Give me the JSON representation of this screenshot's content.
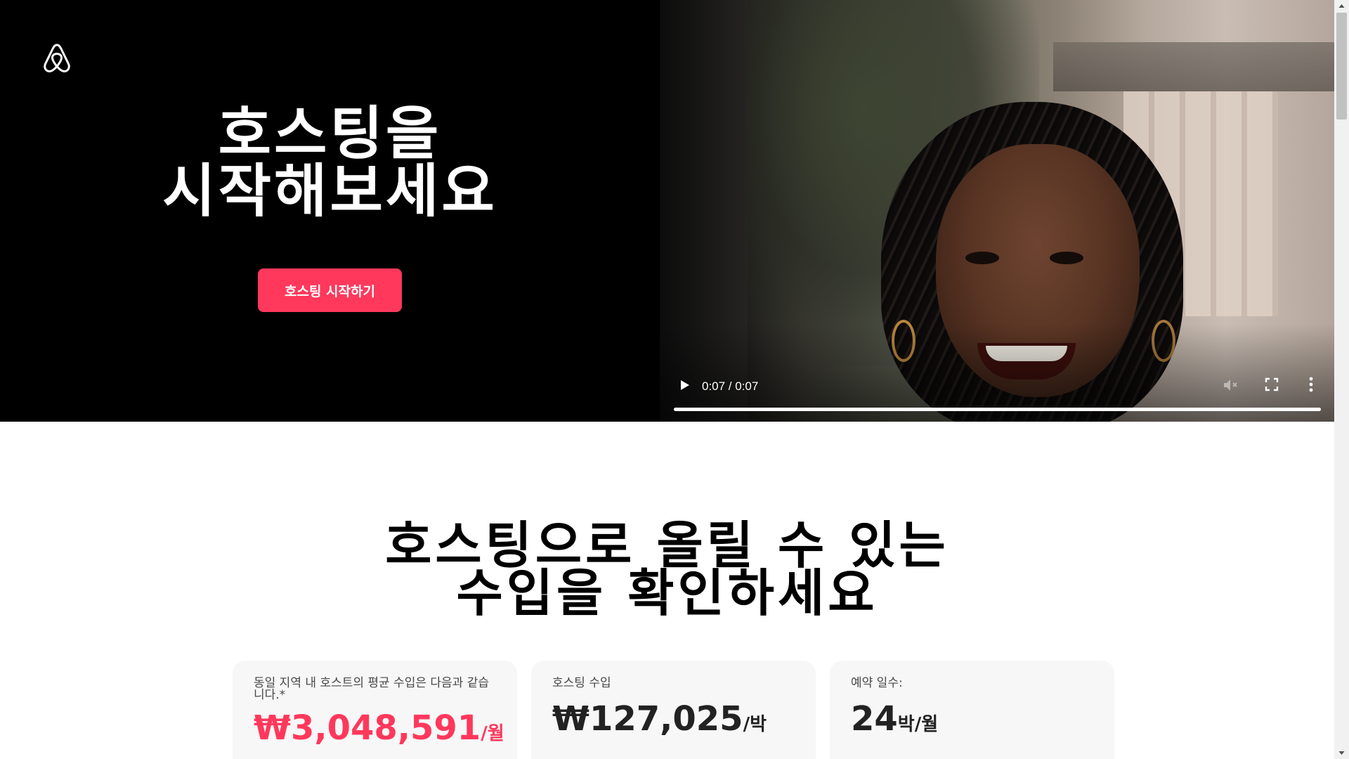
{
  "hero": {
    "logo_icon": "airbnb-logo-icon",
    "title_line1": "호스팅을",
    "title_line2": "시작해보세요",
    "cta_label": "호스팅 시작하기",
    "accent_color": "#ff385c"
  },
  "video": {
    "time_display": "0:07 / 0:07",
    "progress": 1.0,
    "controls": [
      "play-icon",
      "volume-muted-icon",
      "fullscreen-icon",
      "more-options-icon"
    ]
  },
  "earnings": {
    "title_line1": "호스팅으로 올릴 수 있는",
    "title_line2": "수입을 확인하세요",
    "cards": [
      {
        "label": "동일 지역 내 호스트의 평균 수입은 다음과 같습니다.*",
        "value": "₩3,048,591",
        "unit": "/월"
      },
      {
        "label": "호스팅 수입",
        "value": "₩127,025",
        "unit": "/박"
      },
      {
        "label": "예약 일수:",
        "value": "24",
        "unit": "박/월"
      }
    ]
  }
}
